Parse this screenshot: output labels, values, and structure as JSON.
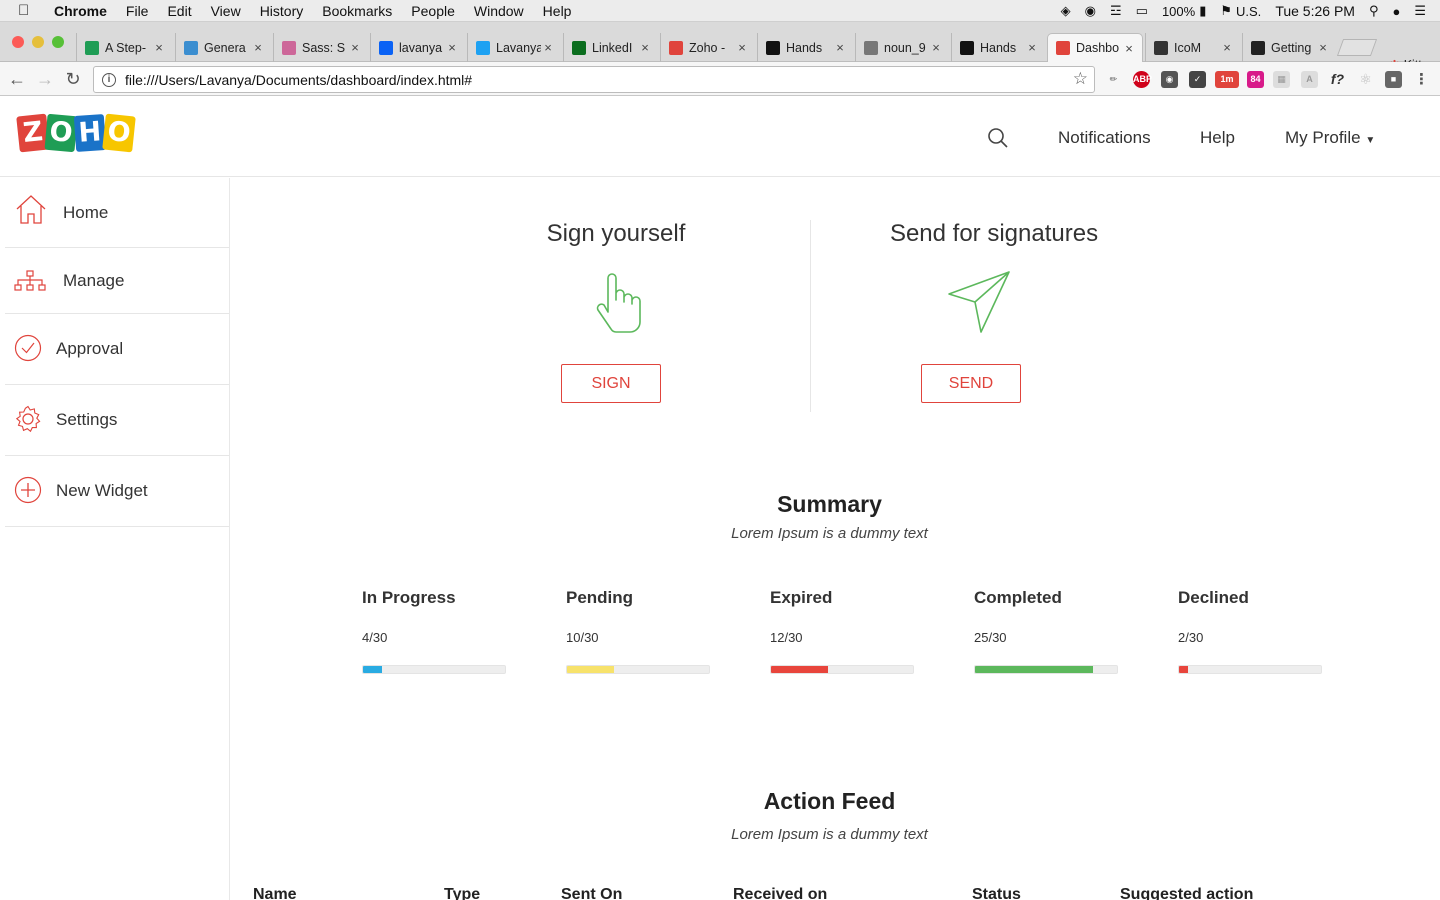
{
  "menubar": {
    "app_name": "Chrome",
    "items": [
      "File",
      "Edit",
      "View",
      "History",
      "Bookmarks",
      "People",
      "Window",
      "Help"
    ],
    "battery": "100%",
    "input_source": "U.S.",
    "clock": "Tue 5:26 PM"
  },
  "tabs": [
    {
      "title": "A Step-",
      "favicon": "m-icon",
      "color": "#1f9d55"
    },
    {
      "title": "Genera",
      "favicon": "c-icon",
      "color": "#3b8ed0"
    },
    {
      "title": "Sass: S",
      "favicon": "sass-icon",
      "color": "#cd6799"
    },
    {
      "title": "lavanya",
      "favicon": "dropbox-icon",
      "color": "#0a62f5"
    },
    {
      "title": "Lavanya",
      "favicon": "twitter-icon",
      "color": "#1da1f2"
    },
    {
      "title": "LinkedI",
      "favicon": "linkedin-icon",
      "color": "#0b6d1e"
    },
    {
      "title": "Zoho -",
      "favicon": "zoho-icon",
      "color": "#e0443c"
    },
    {
      "title": "Hands",
      "favicon": "medium-icon",
      "color": "#111111"
    },
    {
      "title": "noun_9",
      "favicon": "file-icon",
      "color": "#777777"
    },
    {
      "title": "Hands",
      "favicon": "medium-icon",
      "color": "#111111"
    },
    {
      "title": "Dashbo",
      "favicon": "zoho-icon",
      "color": "#e0443c"
    },
    {
      "title": "IcoM",
      "favicon": "icomoon-icon",
      "color": "#333333"
    },
    {
      "title": "Getting",
      "favicon": "react-icon",
      "color": "#222222"
    }
  ],
  "kitty": "Kitty",
  "url": "file:///Users/Lavanya/Documents/dashboard/index.html#",
  "header": {
    "logo_letters": [
      "Z",
      "O",
      "H",
      "O"
    ],
    "logo_colors": [
      "#e0443c",
      "#1f9d55",
      "#1a73c8",
      "#f7c600"
    ],
    "notifications": "Notifications",
    "help": "Help",
    "profile": "My Profile"
  },
  "sidebar": {
    "items": [
      {
        "label": "Home",
        "icon": "home-icon"
      },
      {
        "label": "Manage",
        "icon": "hierarchy-icon"
      },
      {
        "label": "Approval",
        "icon": "check-circle-icon"
      },
      {
        "label": "Settings",
        "icon": "gear-icon"
      },
      {
        "label": "New Widget",
        "icon": "plus-circle-icon"
      }
    ]
  },
  "actions": {
    "sign": {
      "title": "Sign yourself",
      "button": "SIGN",
      "icon": "hand-pointer-icon"
    },
    "send": {
      "title": "Send for signatures",
      "button": "SEND",
      "icon": "paper-plane-icon"
    }
  },
  "summary": {
    "title": "Summary",
    "subtitle": "Lorem Ipsum is a dummy text",
    "stats": [
      {
        "label": "In Progress",
        "count": "4/30",
        "value": 4,
        "total": 30,
        "color": "#29abe2"
      },
      {
        "label": "Pending",
        "count": "10/30",
        "value": 10,
        "total": 30,
        "color": "#f7e26b"
      },
      {
        "label": "Expired",
        "count": "12/30",
        "value": 12,
        "total": 30,
        "color": "#e8453c"
      },
      {
        "label": "Completed",
        "count": "25/30",
        "value": 25,
        "total": 30,
        "color": "#5cb85c"
      },
      {
        "label": "Declined",
        "count": "2/30",
        "value": 2,
        "total": 30,
        "color": "#e8453c"
      }
    ]
  },
  "feed": {
    "title": "Action Feed",
    "subtitle": "Lorem Ipsum is a dummy text",
    "columns": [
      "Name",
      "Type",
      "Sent On",
      "Received on",
      "Status",
      "Suggested action"
    ]
  },
  "colors": {
    "accent": "#e0443c",
    "icon_green": "#5cb85c"
  }
}
